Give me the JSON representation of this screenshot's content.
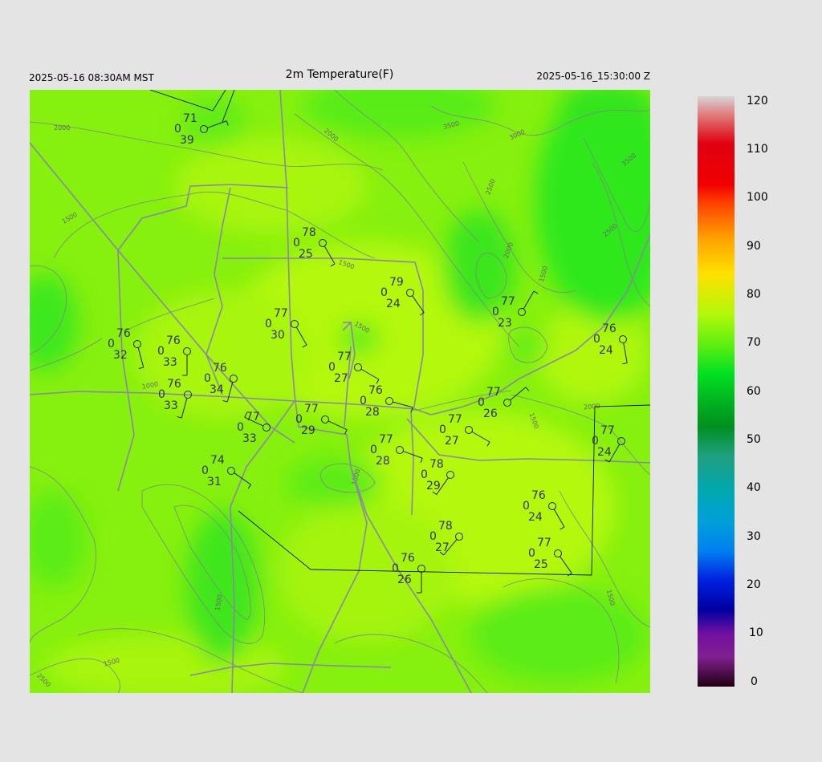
{
  "header": {
    "local_time": "2025-05-16 08:30AM MST",
    "title": "2m Temperature(F)",
    "utc_time": "2025-05-16_15:30:00 Z"
  },
  "colorbar": {
    "labels": [
      "120",
      "110",
      "100",
      "90",
      "80",
      "70",
      "60",
      "50",
      "40",
      "30",
      "20",
      "10",
      "0"
    ],
    "min": 0,
    "max": 120
  },
  "contour_labels": [
    "2000",
    "1500",
    "1000",
    "3500",
    "3000",
    "2500",
    "2000",
    "1500",
    "1500",
    "1500",
    "2000",
    "1500",
    "3500",
    "2500",
    "2000",
    "1500",
    "1500",
    "1500",
    "1500",
    "2500"
  ],
  "stations": [
    {
      "temp": "71",
      "cloud": "0",
      "dew": "39"
    },
    {
      "temp": "78",
      "cloud": "0",
      "dew": "25"
    },
    {
      "temp": "79",
      "cloud": "0",
      "dew": "24"
    },
    {
      "temp": "77",
      "cloud": "0",
      "dew": "23"
    },
    {
      "temp": "76",
      "cloud": "0",
      "dew": "24"
    },
    {
      "temp": "76",
      "cloud": "0",
      "dew": "32"
    },
    {
      "temp": "76",
      "cloud": "0",
      "dew": "33"
    },
    {
      "temp": "77",
      "cloud": "0",
      "dew": "30"
    },
    {
      "temp": "77",
      "cloud": "0",
      "dew": "27"
    },
    {
      "temp": "76",
      "cloud": "0",
      "dew": "34"
    },
    {
      "temp": "76",
      "cloud": "0",
      "dew": "33"
    },
    {
      "temp": "76",
      "cloud": "0",
      "dew": "28"
    },
    {
      "temp": "77",
      "cloud": "0",
      "dew": "26"
    },
    {
      "temp": "77",
      "cloud": "0",
      "dew": "29"
    },
    {
      "temp": "77",
      "cloud": "0",
      "dew": "33"
    },
    {
      "temp": "77",
      "cloud": "0",
      "dew": "27"
    },
    {
      "temp": "77",
      "cloud": "0",
      "dew": "28"
    },
    {
      "temp": "77",
      "cloud": "0",
      "dew": "24"
    },
    {
      "temp": "74",
      "cloud": "0",
      "dew": "31"
    },
    {
      "temp": "78",
      "cloud": "0",
      "dew": "29"
    },
    {
      "temp": "76",
      "cloud": "0",
      "dew": "24"
    },
    {
      "temp": "78",
      "cloud": "0",
      "dew": "27"
    },
    {
      "temp": "77",
      "cloud": "0",
      "dew": "25"
    },
    {
      "temp": "76",
      "cloud": "0",
      "dew": "26"
    }
  ]
}
